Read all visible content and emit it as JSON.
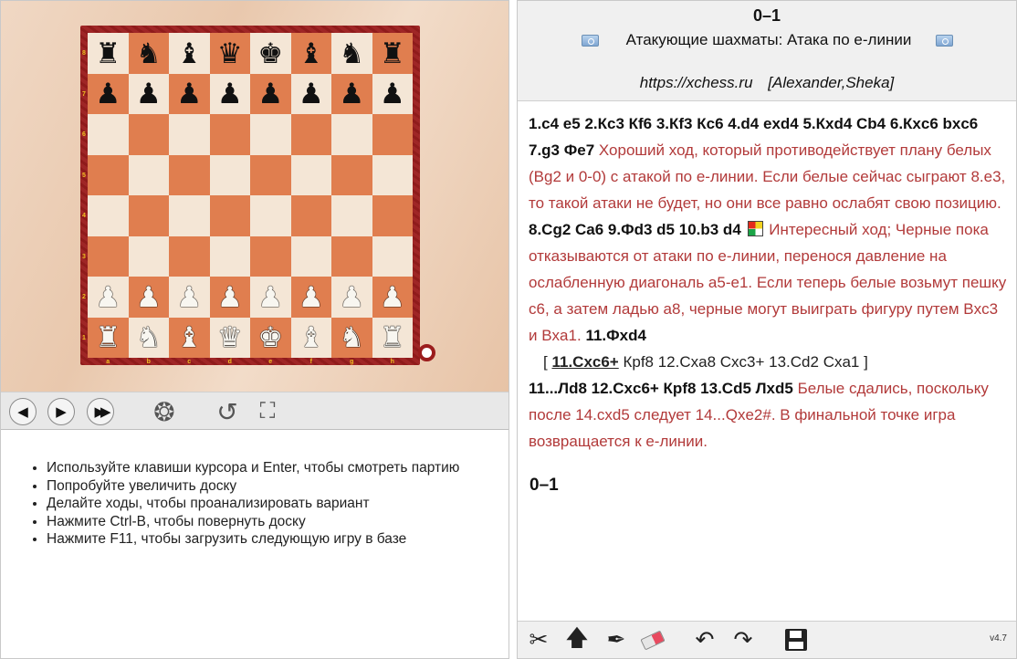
{
  "board": {
    "ranks": [
      "8",
      "7",
      "6",
      "5",
      "4",
      "3",
      "2",
      "1"
    ],
    "files": [
      "a",
      "b",
      "c",
      "d",
      "e",
      "f",
      "g",
      "h"
    ],
    "pieces": {
      "a8": "br",
      "b8": "bn",
      "c8": "bb",
      "d8": "bq",
      "e8": "bk",
      "f8": "bb",
      "g8": "bn",
      "h8": "br",
      "a7": "bp",
      "b7": "bp",
      "c7": "bp",
      "d7": "bp",
      "e7": "bp",
      "f7": "bp",
      "g7": "bp",
      "h7": "bp",
      "a2": "wp",
      "b2": "wp",
      "c2": "wp",
      "d2": "wp",
      "e2": "wp",
      "f2": "wp",
      "g2": "wp",
      "h2": "wp",
      "a1": "wr",
      "b1": "wn",
      "c1": "wb",
      "d1": "wq",
      "e1": "wk",
      "f1": "wb",
      "g1": "wn",
      "h1": "wr"
    }
  },
  "navigation": {
    "back_icon": "arrow-left-icon",
    "forward_icon": "arrow-right-icon",
    "end_icon": "fast-forward-icon",
    "reel_icon": "film-reel-icon",
    "rotate_icon": "rotate-icon",
    "fullscreen_icon": "fullscreen-icon"
  },
  "tips": [
    "Используйте клавиши курсора и Enter, чтобы смотреть партию",
    "Попробуйте увеличить доску",
    "Делайте ходы, чтобы проанализировать вариант",
    "Нажмите Ctrl-B, чтобы повернуть доску",
    "Нажмите F11, чтобы загрузить следующую игру в базе"
  ],
  "header": {
    "result": "0–1",
    "title": "Атакующие шахматы: Атака по е-линии",
    "source": "https://xchess.ru",
    "players": "[Alexander,Sheka]"
  },
  "notation": {
    "moves1": "1.c4  e5  2.Кc3  Кf6  3.Кf3  Кc6  4.d4  exd4  5.Кxd4  Сb4  6.Кxc6  bxc6  7.g3  Фe7",
    "comment1": "Хороший ход, который противодействует плану белых (Bg2 и 0-0) с атакой по е-линии. Если белые сейчас сыграют 8.e3, то такой атаки не будет, но они все равно ослабят свою позицию.",
    "moves2": "8.Сg2  Сa6  9.Фd3  d5  10.b3  d4",
    "comment2": "Интересный ход; Черные пока отказываются от атаки по е-линии, перенося давление на ослабленную диагональ a5-e1. Если теперь белые возьмут пешку c6, а затем ладью a8, черные могут выиграть фигуру путем Bxc3 и Bxa1.",
    "moves3": "11.Фxd4",
    "variation_open": "[",
    "variation_sel": "11.Сxc6+",
    "variation_rest": "Кpf8  12.Сxa8  Сxc3+  13.Сd2  Сxa1",
    "variation_close": "]",
    "moves4": "11...Лd8  12.Сxc6+  Кpf8  13.Сd5  Лxd5",
    "comment3": "Белые сдались, поскольку после 14.cxd5 следует 14...Qxe2#. В финальной точке игра возвращается к е-линии.",
    "final": "0–1"
  },
  "toolbar": {
    "icons": [
      "cut-variation-icon",
      "promote-icon",
      "pen-icon",
      "eraser-icon",
      "undo-icon",
      "redo-icon",
      "save-icon"
    ],
    "version": "v4.7"
  },
  "colors": {
    "light_square": "#f4e6d6",
    "dark_square": "#e07e4f",
    "frame": "#9b1d1d",
    "comment": "#b23a3a"
  }
}
